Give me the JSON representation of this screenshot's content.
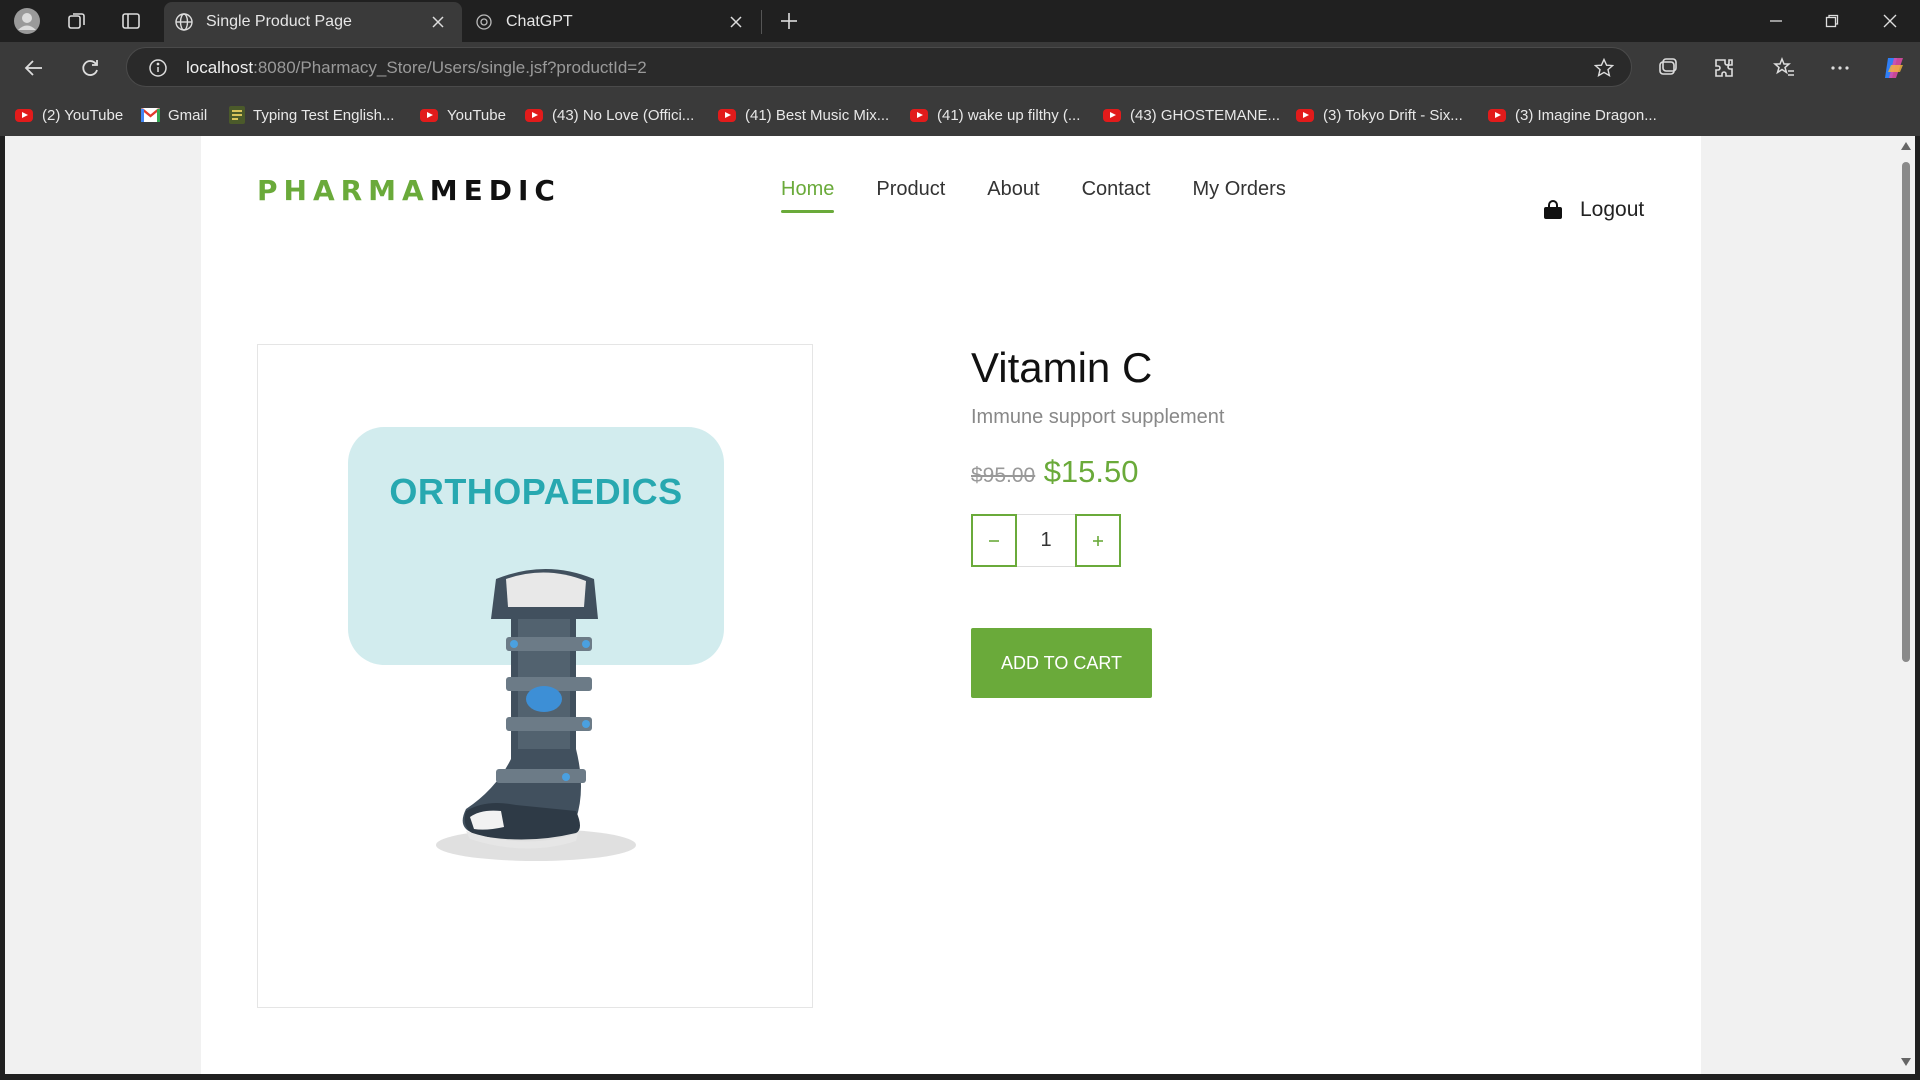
{
  "browser": {
    "tabs": [
      {
        "title": "Single Product Page",
        "active": true
      },
      {
        "title": "ChatGPT",
        "active": false
      }
    ],
    "url": {
      "host": "localhost",
      "rest": ":8080/Pharmacy_Store/Users/single.jsf?productId=2"
    },
    "bookmarks": [
      {
        "label": "(2) YouTube",
        "icon": "youtube-icon"
      },
      {
        "label": "Gmail",
        "icon": "gmail-icon"
      },
      {
        "label": "Typing Test English...",
        "icon": "typing-icon"
      },
      {
        "label": "YouTube",
        "icon": "youtube-icon"
      },
      {
        "label": "(43) No Love (Offici...",
        "icon": "youtube-icon"
      },
      {
        "label": "(41) Best Music Mix...",
        "icon": "youtube-icon"
      },
      {
        "label": "(41) wake up filthy (...",
        "icon": "youtube-icon"
      },
      {
        "label": "(43) GHOSTEMANE...",
        "icon": "youtube-icon"
      },
      {
        "label": "(3) Tokyo Drift - Six...",
        "icon": "youtube-icon"
      },
      {
        "label": "(3) Imagine Dragon...",
        "icon": "youtube-icon"
      }
    ]
  },
  "site": {
    "logo_part1": "PHARMA",
    "logo_part2": "MEDIC",
    "nav": [
      "Home",
      "Product",
      "About",
      "Contact",
      "My Orders"
    ],
    "active_nav": "Home",
    "logout_label": "Logout"
  },
  "product": {
    "image_label": "ORTHOPAEDICS",
    "name": "Vitamin C",
    "description": "Immune support supplement",
    "old_price": "$95.00",
    "price": "$15.50",
    "quantity": "1",
    "add_to_cart_label": "ADD TO CART"
  },
  "colors": {
    "accent": "#6aaa3a",
    "ortho_teal": "#27a8b0",
    "ortho_bg": "#d2ecee"
  }
}
